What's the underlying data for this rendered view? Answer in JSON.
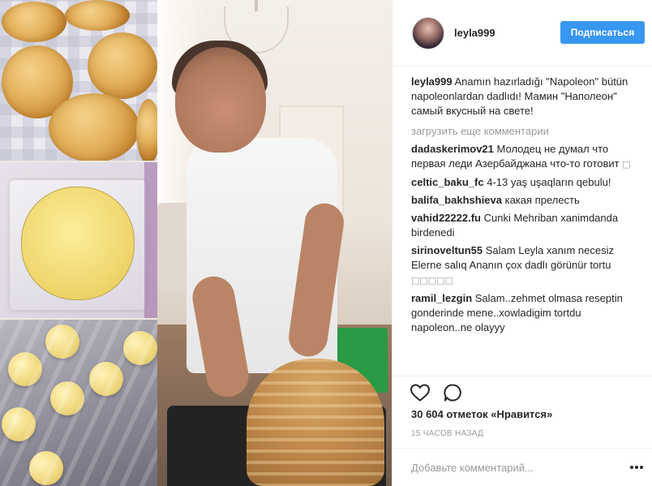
{
  "header": {
    "username": "leyla999",
    "follow_label": "Подписаться"
  },
  "caption": {
    "username": "leyla999",
    "text": " Anamın hazırladığı \"Napoleon\" bütün napoleonlardan dadlıdı! Мамин \"Наполеон\" самый вкусный на свете!"
  },
  "load_more_label": "загрузить еще комментарии",
  "comments": [
    {
      "username": "dadaskerimov21",
      "text": " Молодец не думал что первая леди Азербайджана что-то готовит",
      "glyph": "□"
    },
    {
      "username": "celtic_baku_fc",
      "text": " 4-13 yaş uşaqların qebulu!",
      "glyph": ""
    },
    {
      "username": "balifa_bakhshieva",
      "text": " какая прелесть",
      "glyph": ""
    },
    {
      "username": "vahid22222.fu",
      "text": " Cunki Mehriban xanimdanda birdenedi",
      "glyph": ""
    },
    {
      "username": "sirinoveltun55",
      "text": " Salam Leyla xanım necesiz Elerne salıq Ananın çox dadlı görünür tortu",
      "glyph": "□□□□□"
    },
    {
      "username": "ramil_lezgin",
      "text": " Salam..zehmet olmasa reseptin gonderinde mene..xowladigim tortdu napoleon..ne olayyy",
      "glyph": ""
    }
  ],
  "likes": "30 604 отметок «Нравится»",
  "timestamp": "15 часов назад",
  "add_comment": {
    "placeholder": "Добавьте комментарий..."
  },
  "icons": {
    "like": "heart-outline-icon",
    "comment": "speech-bubble-icon",
    "more": "ellipsis-icon"
  },
  "colors": {
    "accent": "#3897f0",
    "text": "#262626",
    "muted": "#999999",
    "divider": "#efefef"
  }
}
